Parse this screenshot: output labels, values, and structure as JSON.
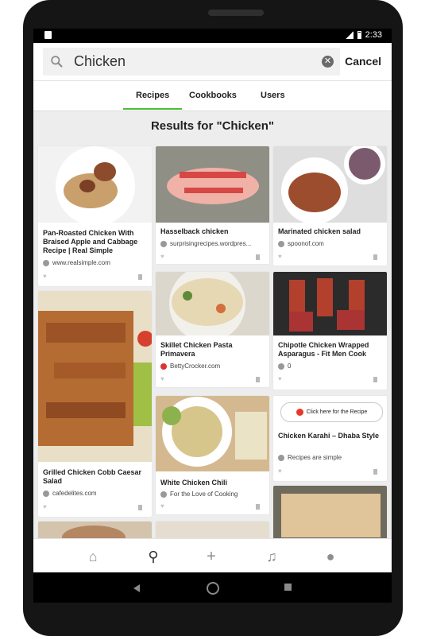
{
  "status": {
    "time": "2:33"
  },
  "search": {
    "query": "Chicken",
    "cancel_label": "Cancel"
  },
  "tabs": [
    {
      "label": "Recipes"
    },
    {
      "label": "Cookbooks"
    },
    {
      "label": "Users"
    }
  ],
  "results": {
    "title": "Results for \"Chicken\""
  },
  "cards": [
    {
      "title": "Pan-Roasted Chicken With Braised Apple and Cabbage Recipe | Real Simple",
      "source": "www.realsimple.com"
    },
    {
      "title": "Hasselback chicken",
      "source": "surprisingrecipes.wordpres..."
    },
    {
      "title": "Marinated chicken salad",
      "source": "spoonof.com"
    },
    {
      "title": "Skillet Chicken Pasta Primavera",
      "source": "BettyCrocker.com"
    },
    {
      "title": "Chipotle Chicken Wrapped Asparagus - Fit Men Cook",
      "source": "0"
    },
    {
      "title": "Grilled Chicken Cobb Caesar Salad",
      "source": "cafedelites.com"
    },
    {
      "title": "White Chicken Chili",
      "source": "For the Love of Cooking"
    },
    {
      "title": "Chicken Karahi – Dhaba Style",
      "source": "Recipes are simple",
      "button": "Click here for the Recipe"
    }
  ],
  "nav": [
    "home-icon",
    "search-icon",
    "add-icon",
    "bell-icon",
    "profile-icon"
  ],
  "colors": {
    "accent": "#4dbb3a"
  }
}
